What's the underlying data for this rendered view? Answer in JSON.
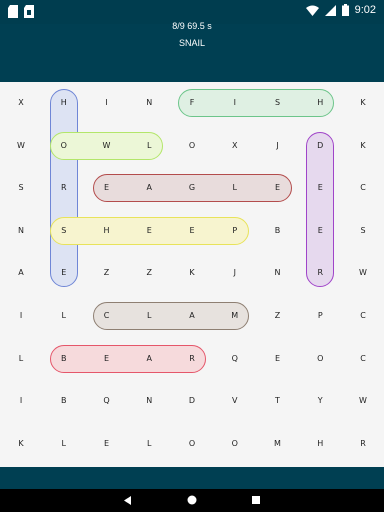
{
  "status_bar": {
    "time": "9:02",
    "left_icons": [
      "sd-card-icon",
      "sim-card-icon"
    ],
    "right_icons": [
      "wifi-icon",
      "signal-icon",
      "battery-icon"
    ]
  },
  "header": {
    "found": "8/9",
    "timer": "69.5 s",
    "current_word": "SNAIL"
  },
  "grid": {
    "rows": [
      [
        "X",
        "H",
        "I",
        "N",
        "F",
        "I",
        "S",
        "H",
        "K"
      ],
      [
        "W",
        "O",
        "W",
        "L",
        "O",
        "X",
        "J",
        "D",
        "K"
      ],
      [
        "S",
        "R",
        "E",
        "A",
        "G",
        "L",
        "E",
        "E",
        "C"
      ],
      [
        "N",
        "S",
        "H",
        "E",
        "E",
        "P",
        "B",
        "E",
        "S"
      ],
      [
        "A",
        "E",
        "Z",
        "Z",
        "K",
        "J",
        "N",
        "R",
        "W"
      ],
      [
        "I",
        "L",
        "C",
        "L",
        "A",
        "M",
        "Z",
        "P",
        "C"
      ],
      [
        "L",
        "B",
        "E",
        "A",
        "R",
        "Q",
        "E",
        "O",
        "C"
      ],
      [
        "I",
        "B",
        "Q",
        "N",
        "D",
        "V",
        "T",
        "Y",
        "W"
      ],
      [
        "K",
        "L",
        "E",
        "L",
        "O",
        "O",
        "M",
        "H",
        "R"
      ]
    ]
  },
  "found_words": [
    {
      "word": "FISH",
      "row": 0,
      "col": 4,
      "dir": "h",
      "len": 4,
      "fill": "#dff0e3",
      "border": "#6cc58a"
    },
    {
      "word": "HORSE",
      "row": 0,
      "col": 1,
      "dir": "v",
      "len": 5,
      "fill": "#dde3f3",
      "border": "#6f86d6"
    },
    {
      "word": "OWL",
      "row": 1,
      "col": 1,
      "dir": "h",
      "len": 3,
      "fill": "#ecf7d7",
      "border": "#b3e66a"
    },
    {
      "word": "DEER",
      "row": 1,
      "col": 7,
      "dir": "v",
      "len": 4,
      "fill": "#e6d9ee",
      "border": "#a044c9"
    },
    {
      "word": "EAGLE",
      "row": 2,
      "col": 2,
      "dir": "h",
      "len": 5,
      "fill": "#e8dcdc",
      "border": "#b34c4c"
    },
    {
      "word": "SHEEP",
      "row": 3,
      "col": 1,
      "dir": "h",
      "len": 5,
      "fill": "#f7f4cf",
      "border": "#e8e35a"
    },
    {
      "word": "CLAM",
      "row": 5,
      "col": 2,
      "dir": "h",
      "len": 4,
      "fill": "#e7e2de",
      "border": "#8e7f72"
    },
    {
      "word": "BEAR",
      "row": 6,
      "col": 1,
      "dir": "h",
      "len": 4,
      "fill": "#f6dadc",
      "border": "#e5566a"
    }
  ]
}
